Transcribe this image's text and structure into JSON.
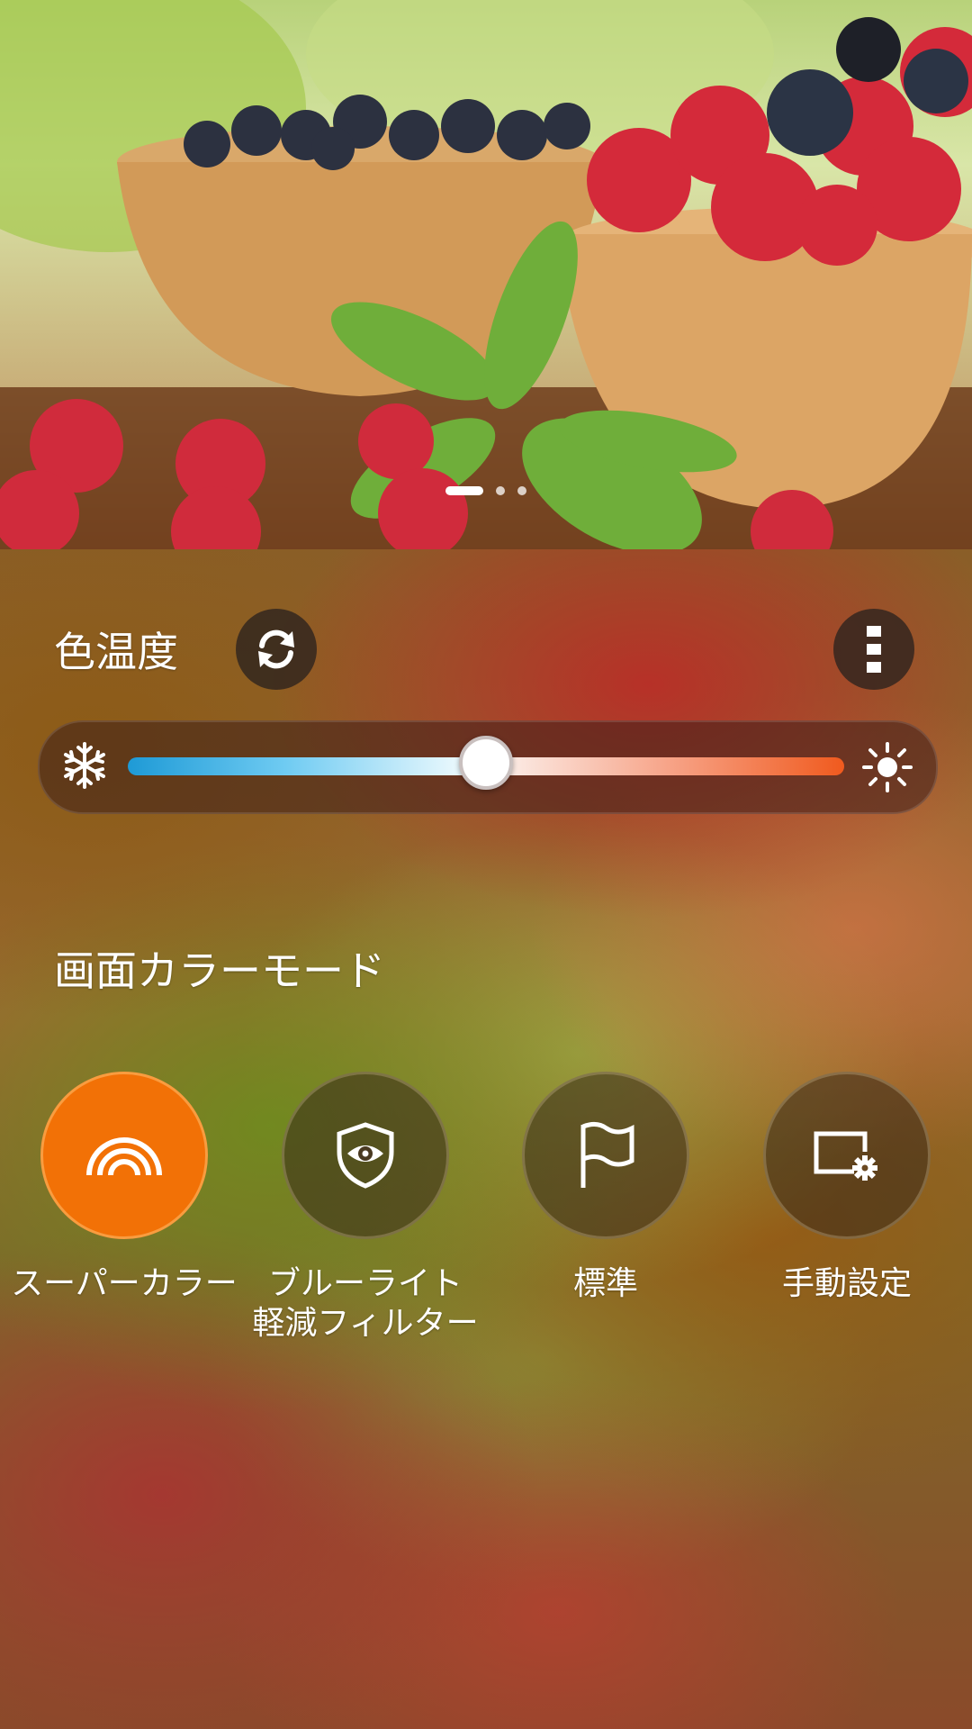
{
  "color_temperature": {
    "title": "色温度",
    "reset_icon": "refresh-icon",
    "menu_icon": "more-vertical-icon",
    "slider": {
      "cool_icon": "snowflake-icon",
      "warm_icon": "sun-icon",
      "value_fraction": 0.5,
      "gradient_colors": [
        "#1e9ad6",
        "#e9f8fd",
        "#f05a1e"
      ]
    }
  },
  "preview": {
    "page_count": 3,
    "active_page": 0
  },
  "color_mode": {
    "title": "画面カラーモード",
    "accent_color": "#f27106",
    "modes": [
      {
        "label": "スーパーカラー",
        "icon": "rainbow-icon",
        "selected": true
      },
      {
        "label": "ブルーライト\n軽減フィルター",
        "icon": "eye-shield-icon",
        "selected": false
      },
      {
        "label": "標準",
        "icon": "flag-icon",
        "selected": false
      },
      {
        "label": "手動設定",
        "icon": "screen-settings-icon",
        "selected": false
      }
    ]
  }
}
